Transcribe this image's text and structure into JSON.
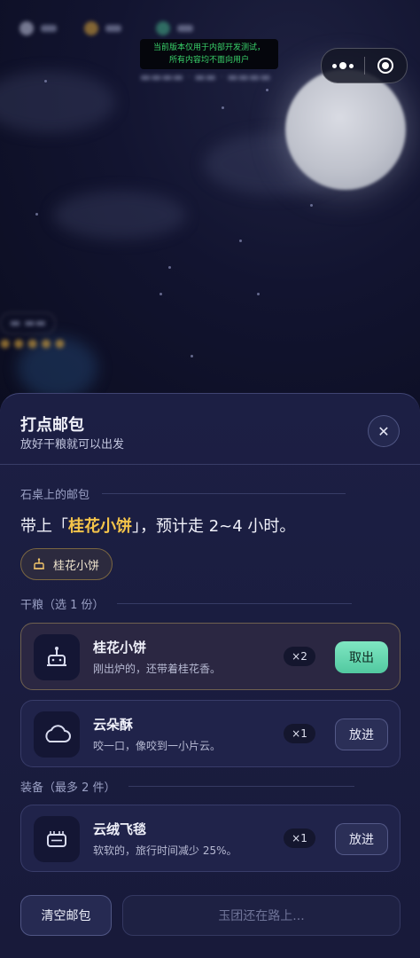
{
  "dev_banner": {
    "line1": "当前版本仅用于内部开发测试，",
    "line2": "所有内容均不面向用户"
  },
  "sheet": {
    "title": "打点邮包",
    "subtitle": "放好干粮就可以出发",
    "close_icon": "close-icon",
    "section_mailbag": "石桌上的邮包",
    "headline": {
      "prefix": "带上「",
      "item": "桂花小饼",
      "suffix": "」，预计走 2~4 小时。"
    },
    "tag_label": "桂花小饼",
    "section_food": "干粮（选 1 份）",
    "section_gear": "装备（最多 2 件）",
    "food_items": [
      {
        "name": "桂花小饼",
        "desc": "刚出炉的，还带着桂花香。",
        "count": "×2",
        "action": "取出",
        "selected": true,
        "icon": "mooncake-icon"
      },
      {
        "name": "云朵酥",
        "desc": "咬一口，像咬到一小片云。",
        "count": "×1",
        "action": "放进",
        "selected": false,
        "icon": "cloud-icon"
      }
    ],
    "gear_items": [
      {
        "name": "云绒飞毯",
        "desc": "软软的，旅行时间减少 25%。",
        "count": "×1",
        "action": "放进",
        "icon": "carpet-icon"
      }
    ],
    "clear_label": "清空邮包",
    "go_label": "玉团还在路上..."
  },
  "colors": {
    "accent_gold": "#f4c44a",
    "primary_green": "#6fdcb5",
    "sheet_bg": "#1c1f44"
  }
}
